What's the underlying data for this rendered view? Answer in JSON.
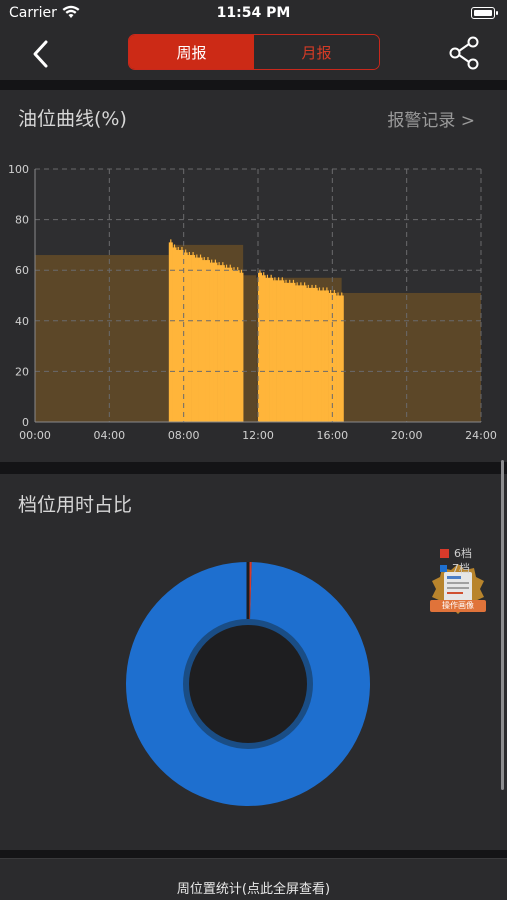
{
  "status_bar": {
    "carrier": "Carrier",
    "time": "11:54 PM"
  },
  "nav": {
    "tabs": [
      {
        "label": "周报",
        "active": true
      },
      {
        "label": "月报",
        "active": false
      }
    ],
    "back_icon": "chevron-left-icon",
    "share_icon": "share-icon"
  },
  "fuel_section": {
    "title": "油位曲线(%)",
    "alarm_link": "报警记录 >"
  },
  "gear_section": {
    "title": "档位用时占比",
    "legend": [
      {
        "label": "6档",
        "color": "#d83a2a"
      },
      {
        "label": "7档",
        "color": "#1e6fcf"
      }
    ],
    "badge_label": "操作画像"
  },
  "footer": {
    "text": "周位置统计(点此全屏查看)"
  },
  "colors": {
    "accent": "#cc2a16",
    "bar": "#ffb53a",
    "fill": "#5c4728",
    "donut": "#1e6fcf"
  },
  "chart_data": [
    {
      "type": "bar",
      "title": "油位曲线(%)",
      "x_ticks": [
        "00:00",
        "04:00",
        "08:00",
        "12:00",
        "16:00",
        "20:00",
        "24:00"
      ],
      "y_ticks": [
        "0",
        "20",
        "40",
        "60",
        "80",
        "100"
      ],
      "xlim": [
        0,
        24
      ],
      "ylim": [
        0,
        100
      ],
      "baseline_segments": [
        {
          "x": [
            0,
            7.2
          ],
          "value": 66
        },
        {
          "x": [
            7.2,
            11.2
          ],
          "value": 70
        },
        {
          "x": [
            11.2,
            11.9
          ],
          "value": 58
        },
        {
          "x": [
            11.9,
            16.5
          ],
          "value": 57
        },
        {
          "x": [
            16.5,
            24
          ],
          "value": 51
        }
      ],
      "series": [
        {
          "x": [
            7.2,
            7.4,
            7.6,
            7.8,
            8.0,
            8.2,
            8.4,
            8.6,
            8.8,
            9.0,
            9.2,
            9.4,
            9.6,
            9.8,
            10.0,
            10.2,
            10.4,
            10.6,
            10.8,
            11.0,
            12.0,
            12.2,
            12.4,
            12.6,
            12.8,
            13.0,
            13.2,
            13.4,
            13.6,
            13.8,
            14.0,
            14.2,
            14.4,
            14.6,
            14.8,
            15.0,
            15.2,
            15.4,
            15.6,
            15.8,
            16.0,
            16.2,
            16.4
          ],
          "values": [
            71,
            69,
            68,
            68,
            67,
            66,
            66,
            65,
            65,
            64,
            64,
            63,
            63,
            62,
            62,
            61,
            61,
            60,
            60,
            59,
            59,
            58,
            57,
            57,
            56,
            56,
            56,
            55,
            55,
            55,
            54,
            54,
            54,
            53,
            53,
            53,
            52,
            52,
            52,
            51,
            51,
            50,
            50
          ]
        }
      ]
    },
    {
      "type": "pie",
      "title": "档位用时占比",
      "labels": [
        "6档",
        "7档"
      ],
      "values": [
        0.5,
        99.5
      ]
    }
  ]
}
